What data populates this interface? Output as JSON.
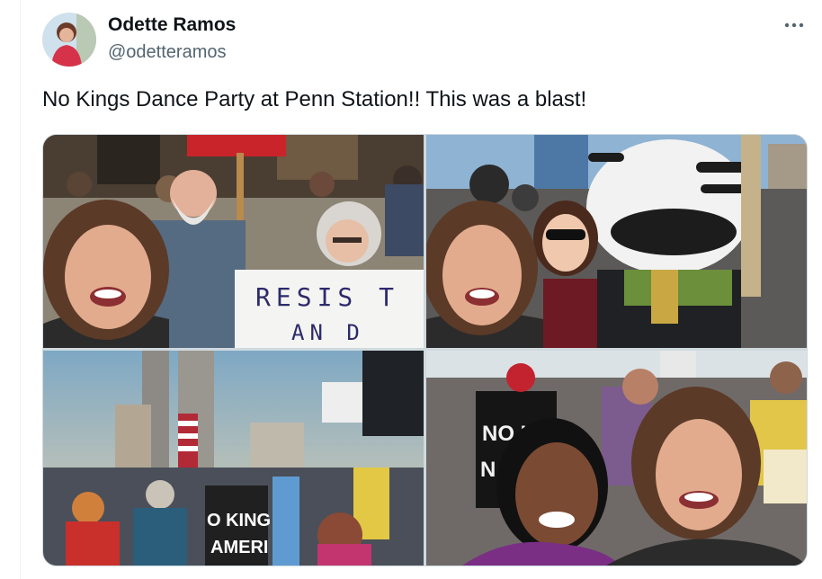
{
  "author": {
    "display_name": "Odette Ramos",
    "handle": "@odetteramos",
    "avatar_icon": "profile-photo"
  },
  "more_icon": "ellipsis-icon",
  "tweet": {
    "text": "No Kings Dance Party at Penn Station!! This was a blast!"
  },
  "media": {
    "photos": [
      {
        "description": "selfie-with-protesters"
      },
      {
        "description": "selfie-with-costumed-dancer"
      },
      {
        "description": "rally-crowd-with-flags"
      },
      {
        "description": "selfie-with-friend"
      }
    ]
  },
  "colors": {
    "text_primary": "#0f1419",
    "text_secondary": "#536471",
    "border": "#cfd9de"
  }
}
